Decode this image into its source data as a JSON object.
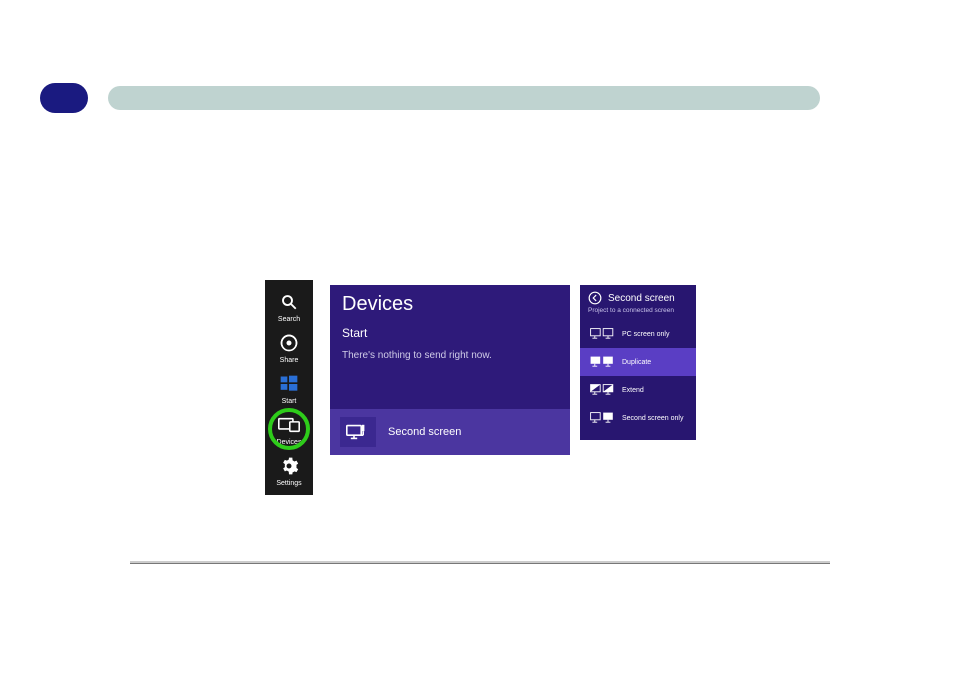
{
  "colors": {
    "badge": "#1a1a80",
    "titleBar": "#bfd3d0",
    "highlight": "#2ecc1a",
    "panelBg": "#2e1a7a",
    "panelRow": "#4b36a0",
    "flyoutBg": "#281670",
    "flyoutSelected": "#5a3ec4"
  },
  "charms": {
    "items": [
      {
        "label": "Search",
        "icon": "search-icon"
      },
      {
        "label": "Share",
        "icon": "share-icon"
      },
      {
        "label": "Start",
        "icon": "start-icon"
      },
      {
        "label": "Devices",
        "icon": "devices-icon"
      },
      {
        "label": "Settings",
        "icon": "settings-icon"
      }
    ]
  },
  "devices_panel": {
    "title": "Devices",
    "subtitle": "Start",
    "message": "There's nothing to send right now.",
    "second_screen_label": "Second screen"
  },
  "second_screen_flyout": {
    "title": "Second screen",
    "subtitle": "Project to a connected screen",
    "options": [
      {
        "label": "PC screen only"
      },
      {
        "label": "Duplicate"
      },
      {
        "label": "Extend"
      },
      {
        "label": "Second screen only"
      }
    ],
    "selected_index": 1
  }
}
